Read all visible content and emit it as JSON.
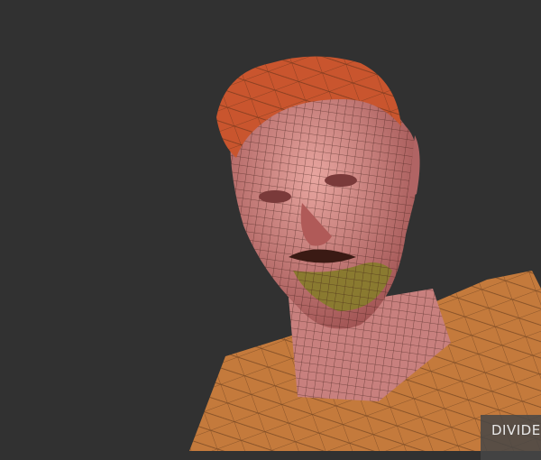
{
  "viewport": {
    "background": "#313131",
    "model": "sculpted-head-wireframe",
    "colors": {
      "skin": "#b86a6a",
      "hair": "#c9552e",
      "clothing": "#c87a3a",
      "beard": "#8a7a30",
      "wire": "#3a1a14"
    }
  },
  "overlay": {
    "label": "DIVIDE"
  }
}
